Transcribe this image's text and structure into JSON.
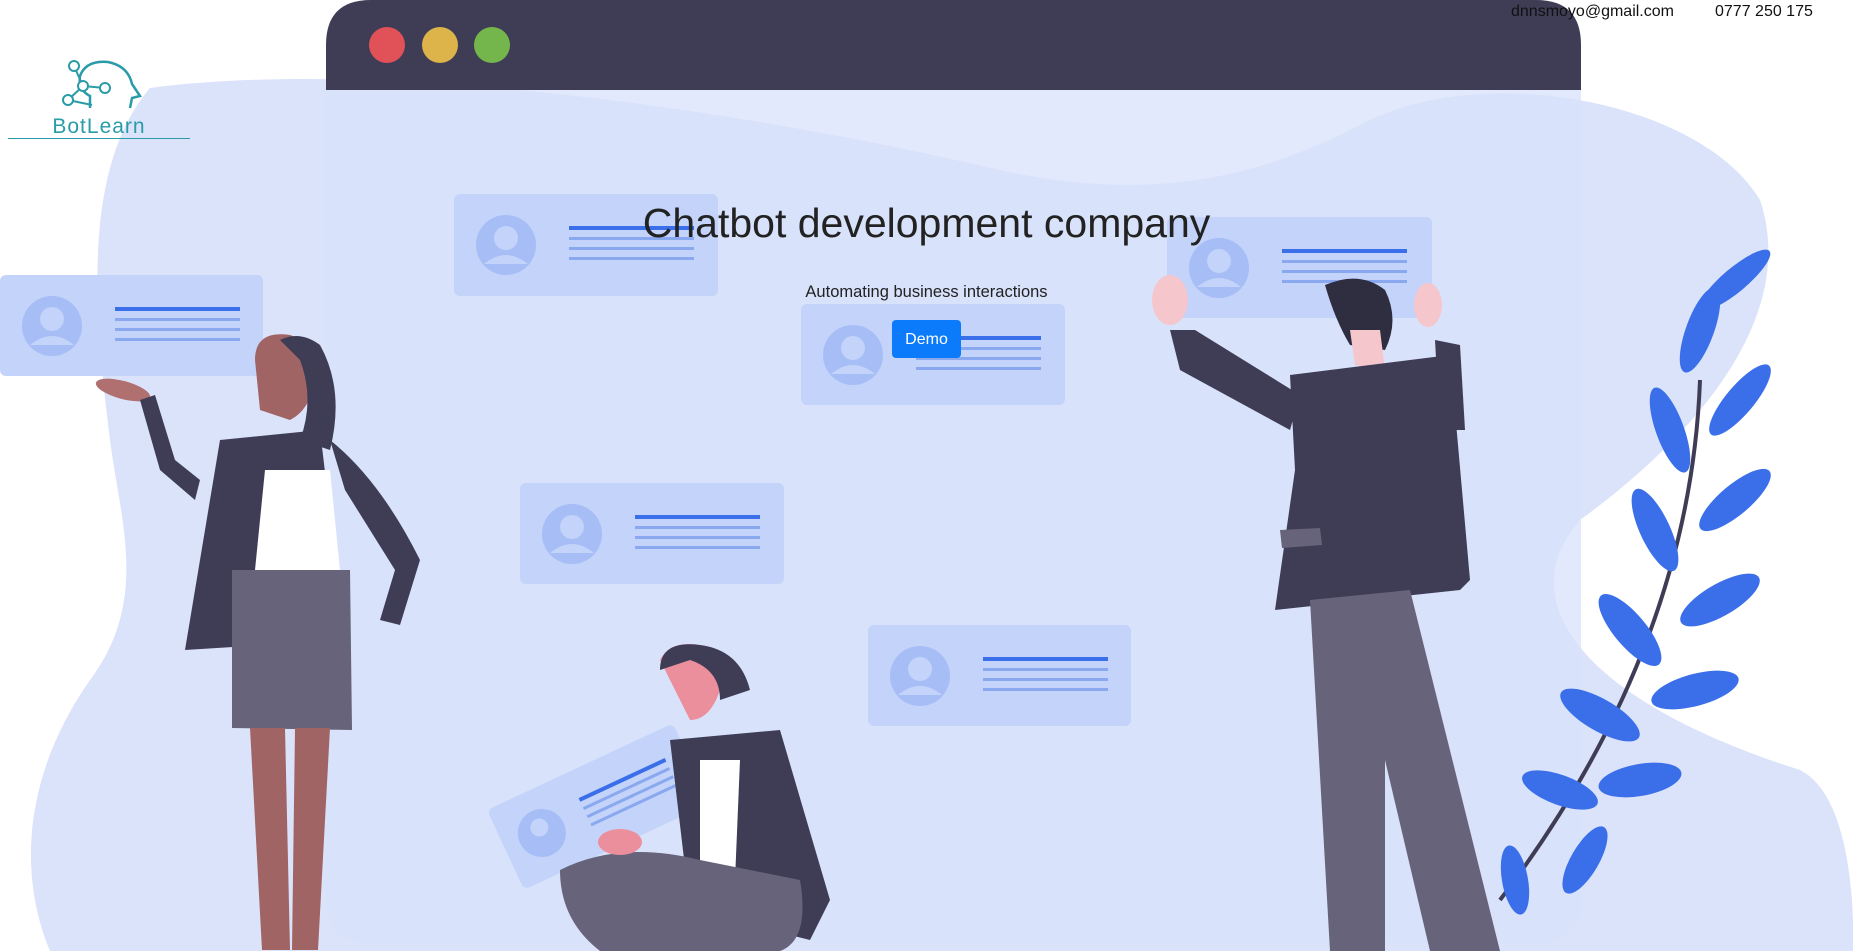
{
  "brand": {
    "name": "BotLearn",
    "color": "#2a9ba8"
  },
  "header": {
    "email": "dnnsmoyo@gmail.com",
    "phone": "0777 250 175"
  },
  "hero": {
    "title": "Chatbot development company",
    "subtitle": "Automating business interactions",
    "demo_label": "Demo"
  },
  "colors": {
    "button": "#0b7bfb",
    "blob": "#dbe3fb",
    "browser_bar": "#3f3d56",
    "card": "#c3d3f9",
    "card_line": "#3b6fea",
    "dot_red": "#e05158",
    "dot_yellow": "#dcb44a",
    "dot_green": "#74b64b"
  }
}
